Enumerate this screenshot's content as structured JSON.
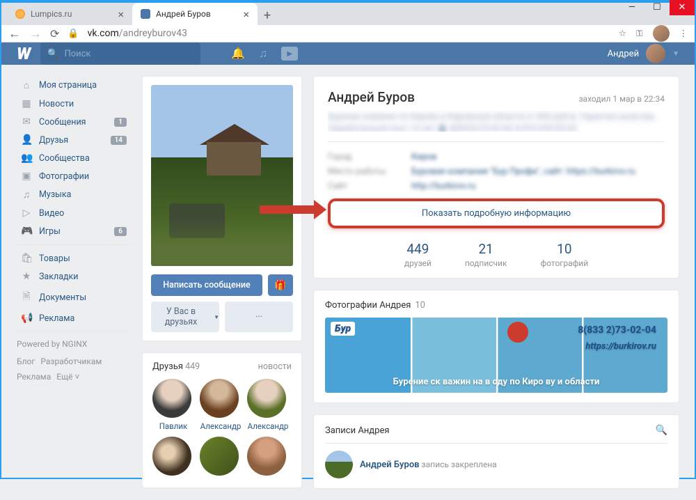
{
  "browser": {
    "tabs": [
      {
        "title": "Lumpics.ru"
      },
      {
        "title": "Андрей Буров"
      }
    ],
    "new_tab": "+",
    "url_domain": "vk.com",
    "url_path": "/andreyburov43"
  },
  "header": {
    "logo": "W",
    "search_placeholder": "Поиск",
    "user_name": "Андрей"
  },
  "nav": {
    "items": [
      {
        "icon": "⌂",
        "label": "Моя страница"
      },
      {
        "icon": "▦",
        "label": "Новости"
      },
      {
        "icon": "✉",
        "label": "Сообщения",
        "badge": "1"
      },
      {
        "icon": "👤",
        "label": "Друзья",
        "badge": "14"
      },
      {
        "icon": "👥",
        "label": "Сообщества"
      },
      {
        "icon": "▣",
        "label": "Фотографии"
      },
      {
        "icon": "♫",
        "label": "Музыка"
      },
      {
        "icon": "▷",
        "label": "Видео"
      },
      {
        "icon": "🎮",
        "label": "Игры",
        "badge": "6"
      }
    ],
    "items2": [
      {
        "icon": "🛍",
        "label": "Товары"
      },
      {
        "icon": "★",
        "label": "Закладки"
      },
      {
        "icon": "🗎",
        "label": "Документы"
      },
      {
        "icon": "📢",
        "label": "Реклама"
      }
    ],
    "powered": "Powered by NGINX",
    "links": [
      "Блог",
      "Разработчикам",
      "Реклама",
      "Ещё ˅"
    ]
  },
  "profile_left": {
    "write_msg": "Написать сообщение",
    "friend_status": "У Вас в друзьях",
    "dots": "···"
  },
  "friends_block": {
    "title": "Друзья",
    "count": "449",
    "news": "новости",
    "list": [
      {
        "name": "Павлик"
      },
      {
        "name": "Александр"
      },
      {
        "name": "Александр"
      },
      {
        "name": ""
      },
      {
        "name": ""
      },
      {
        "name": ""
      }
    ]
  },
  "profile": {
    "name": "Андрей Буров",
    "last_seen": "заходил 1 мар в 22:34",
    "status_blur": "Бурение скважин по Кирову и Кировской области от 800 руб/м. Гарантия качества. Наработанный опыт 10 лет 🔥 8(8332)73-02-04; 8-922-993-02-04",
    "info_rows": [
      {
        "label": "Город",
        "value": "Киров"
      },
      {
        "label": "Место работы",
        "value": "Буровая компания \"Бур Профи\", сайт: https://burkirov.ru"
      },
      {
        "label": "Сайт",
        "value": "http://burkirov.ru"
      }
    ],
    "show_info": "Показать подробную информацию",
    "counters": [
      {
        "value": "449",
        "label": "друзей"
      },
      {
        "value": "21",
        "label": "подписчик"
      },
      {
        "value": "10",
        "label": "фотографий"
      }
    ]
  },
  "photos": {
    "title": "Фотографии Андрея",
    "count": "10",
    "logo": "Бур",
    "phone": "8(833 2)73-02-04",
    "url": "https://burkirov.ru",
    "caption": "Бурение ск важин на в оду по Киро ву и области"
  },
  "wall": {
    "title": "Записи Андрея",
    "author": "Андрей Буров",
    "pinned": "запись закреплена"
  }
}
